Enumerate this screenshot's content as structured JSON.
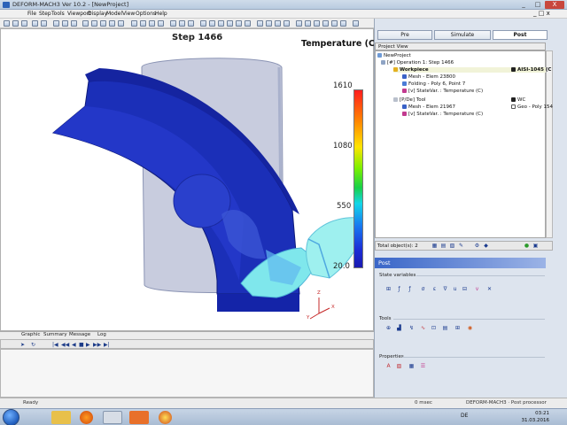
{
  "window": {
    "title": "DEFORM-MACH3  Ver 10.2 - [NewProject]",
    "controls": [
      "_",
      "□",
      "X"
    ]
  },
  "menu": [
    "File",
    "Step",
    "Tools",
    "Viewport",
    "Display",
    "Model",
    "View",
    "Options",
    "Help"
  ],
  "viewport": {
    "step_label": "Step 1466",
    "legend_title": "Temperature (C)",
    "legend_ticks": [
      "1610",
      "1080",
      "550",
      "20.0"
    ],
    "axis_labels": {
      "x": "X",
      "y": "Y",
      "z": "Z"
    }
  },
  "bottom_tabs": [
    "Graphic",
    "Summary",
    "Message",
    "Log"
  ],
  "right_panel": {
    "tabs": [
      "Pre",
      "Simulate",
      "Post"
    ],
    "active_tab": "Post",
    "project_view_label": "Project View",
    "tree": {
      "project": "NewProject",
      "operation": "[#] Operation 1: Step 1466",
      "workpiece": "Workpiece",
      "workpiece_material": "AISI-1045 (C",
      "mesh1": "Mesh - Elem 23800",
      "folding": "Folding - Poly 6, Point 7",
      "statevar1": "[v] StateVar. : Temperature (C)",
      "tool": "[P/De] Tool",
      "tool_material": "WC",
      "mesh2": "Mesh - Elem 21967",
      "geo": "Geo - Poly 154",
      "statevar2": "[v] StateVar. : Temperature (C)"
    },
    "total_objects": "Total object(s): 2",
    "post_header": "Post",
    "sections": [
      "State variables",
      "Tools",
      "Properties"
    ]
  },
  "status": {
    "left": "Ready",
    "time": "0 msec",
    "mode": "DEFORM-MACH3   ·   Post processor"
  },
  "taskbar": {
    "lang": "DE",
    "clock_time": "03:21",
    "clock_date": "31.03.2016"
  },
  "colors": {
    "accent": "#3a66c8",
    "workpiece": "#1b2fb8",
    "tool_transparent": "#9aa3c2",
    "chip": "#7fe7ec"
  }
}
